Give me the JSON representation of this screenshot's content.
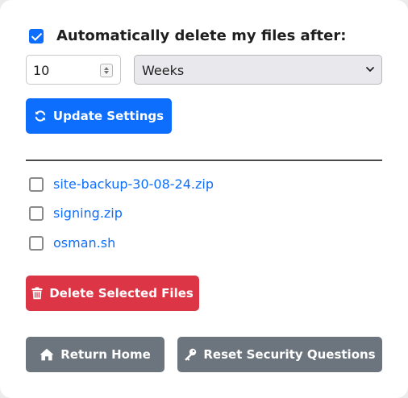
{
  "auto_delete": {
    "checked": true,
    "label": "Automatically delete my files after:",
    "amount": "10",
    "unit_selected": "Weeks"
  },
  "buttons": {
    "update": "Update Settings",
    "delete": "Delete Selected Files",
    "home": "Return Home",
    "reset": "Reset Security Questions"
  },
  "files": [
    {
      "name": "site-backup-30-08-24.zip",
      "checked": false
    },
    {
      "name": "signing.zip",
      "checked": false
    },
    {
      "name": "osman.sh",
      "checked": false
    }
  ],
  "colors": {
    "primary": "#0d6efd",
    "danger": "#dc3545",
    "secondary": "#6c757d"
  },
  "icons": {
    "update": "sync-icon",
    "delete": "trash-icon",
    "home": "home-icon",
    "reset": "key-icon"
  }
}
